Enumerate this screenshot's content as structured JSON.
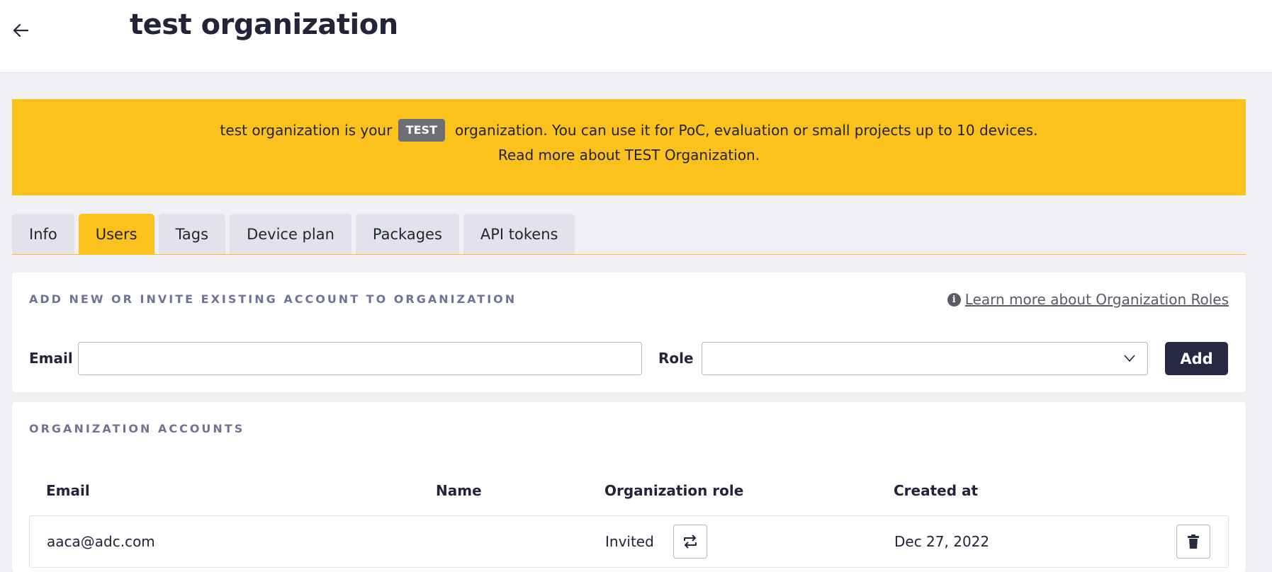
{
  "header": {
    "title": "test organization",
    "back_icon": "arrow-left-icon"
  },
  "banner": {
    "prefix": "test organization is your",
    "badge": "TEST",
    "suffix": "organization. You can use it for PoC, evaluation or small projects up to 10 devices.",
    "read_more": "Read more about TEST Organization.",
    "color": "#fbc11c"
  },
  "tabs": [
    {
      "label": "Info",
      "active": false
    },
    {
      "label": "Users",
      "active": true
    },
    {
      "label": "Tags",
      "active": false
    },
    {
      "label": "Device plan",
      "active": false
    },
    {
      "label": "Packages",
      "active": false
    },
    {
      "label": "API tokens",
      "active": false
    }
  ],
  "add_section": {
    "title": "ADD NEW OR INVITE EXISTING ACCOUNT TO ORGANIZATION",
    "learn_more": "Learn more about Organization Roles",
    "email_label": "Email",
    "email_value": "",
    "role_label": "Role",
    "role_value": "",
    "add_label": "Add"
  },
  "accounts": {
    "title": "ORGANIZATION ACCOUNTS",
    "columns": [
      "Email",
      "Name",
      "Organization role",
      "Created at"
    ],
    "rows": [
      {
        "email": "aaca@adc.com",
        "name": "",
        "role": "Invited",
        "created_at": "Dec 27, 2022"
      }
    ]
  },
  "colors": {
    "accent": "#fbc11c",
    "primary_button": "#272842",
    "section_title": "#6f7394"
  }
}
